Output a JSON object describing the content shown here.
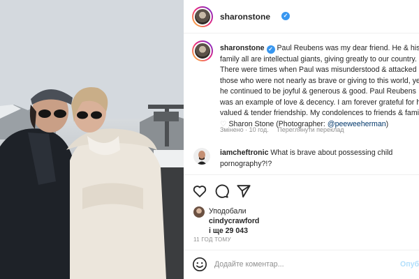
{
  "post": {
    "username": "sharonstone",
    "verified_mark": "✓",
    "caption": {
      "username": "sharonstone",
      "text_before_link": "Paul Reubens was my dear friend. He & his family all are intellectual giants, giving greatly to our country. There were times when Paul was misunderstood & attacked by those who were not nearly as brave or giving to this world, yet he continued to be joyful & generous & good. Paul Reubens was an example of love & decency. I am forever grateful for his valued & tender friendship. My condolences to friends & family.",
      "heart": "♡",
      "signature": "Sharon Stone",
      "photographer_prefix": "(Photographer: ",
      "photographer_link": "@peeweeherman",
      "photographer_suffix": ")"
    },
    "meta": {
      "edited": "Змінено · 10 год.",
      "translate": "Переглянути переклад"
    },
    "comment": {
      "username": "iamcheftronic",
      "text": "What is brave about possessing child pornography?!?"
    },
    "actions": {
      "like_icon": "heart-outline-icon",
      "comment_icon": "comment-bubble-icon",
      "share_icon": "paper-plane-icon"
    },
    "likes": {
      "title": "Уподобали",
      "user": "cindycrawford",
      "count_text": "і ще 29 043"
    },
    "time_ago": "11 ГОД ТОМУ",
    "add_comment": {
      "placeholder": "Додайте коментар...",
      "publish_label": "Опублікувати"
    }
  },
  "colors": {
    "link": "#00376b",
    "verified": "#3897f0",
    "publish_disabled": "#b2dffc",
    "muted": "#8e8e8e"
  }
}
